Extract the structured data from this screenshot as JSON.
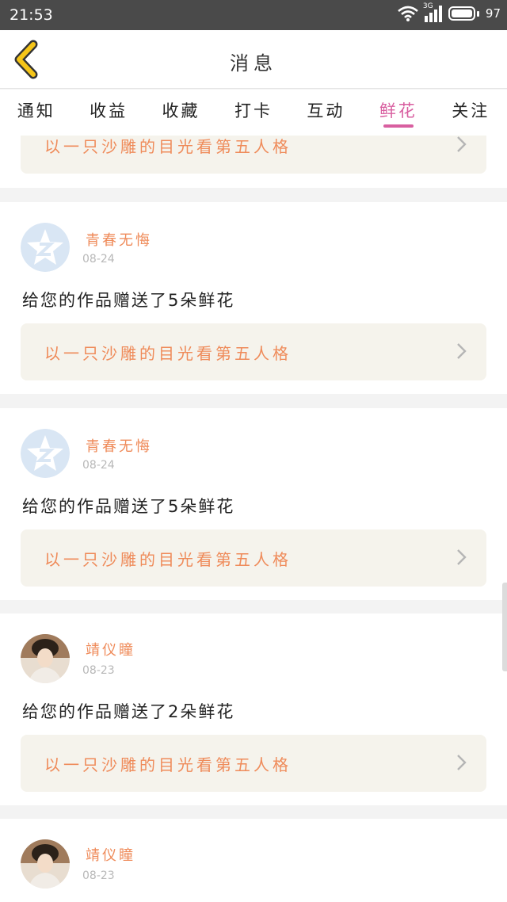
{
  "status_bar": {
    "time": "21:53",
    "network": "3G",
    "battery": "97"
  },
  "header": {
    "title": "消息",
    "back_icon": "chevron-left-icon",
    "back_color": "#f5c518"
  },
  "tabs": [
    {
      "label": "通知",
      "active": false
    },
    {
      "label": "收益",
      "active": false
    },
    {
      "label": "收藏",
      "active": false
    },
    {
      "label": "打卡",
      "active": false
    },
    {
      "label": "互动",
      "active": false
    },
    {
      "label": "鲜花",
      "active": true
    },
    {
      "label": "关注",
      "active": false
    }
  ],
  "colors": {
    "accent": "#d85fa0",
    "orange": "#ef8b5a",
    "date_gray": "#b8b8b8"
  },
  "partial_card": {
    "work_title": "以一只沙雕的目光看第五人格"
  },
  "messages": [
    {
      "user": "青春无悔",
      "date": "08-24",
      "text": "给您的作品赠送了5朵鲜花",
      "work_title": "以一只沙雕的目光看第五人格",
      "avatar": "qq-default-avatar"
    },
    {
      "user": "青春无悔",
      "date": "08-24",
      "text": "给您的作品赠送了5朵鲜花",
      "work_title": "以一只沙雕的目光看第五人格",
      "avatar": "qq-default-avatar"
    },
    {
      "user": "靖仪瞳",
      "date": "08-23",
      "text": "给您的作品赠送了2朵鲜花",
      "work_title": "以一只沙雕的目光看第五人格",
      "avatar": "user-photo-avatar"
    },
    {
      "user": "靖仪瞳",
      "date": "08-23",
      "avatar": "user-photo-avatar"
    }
  ]
}
